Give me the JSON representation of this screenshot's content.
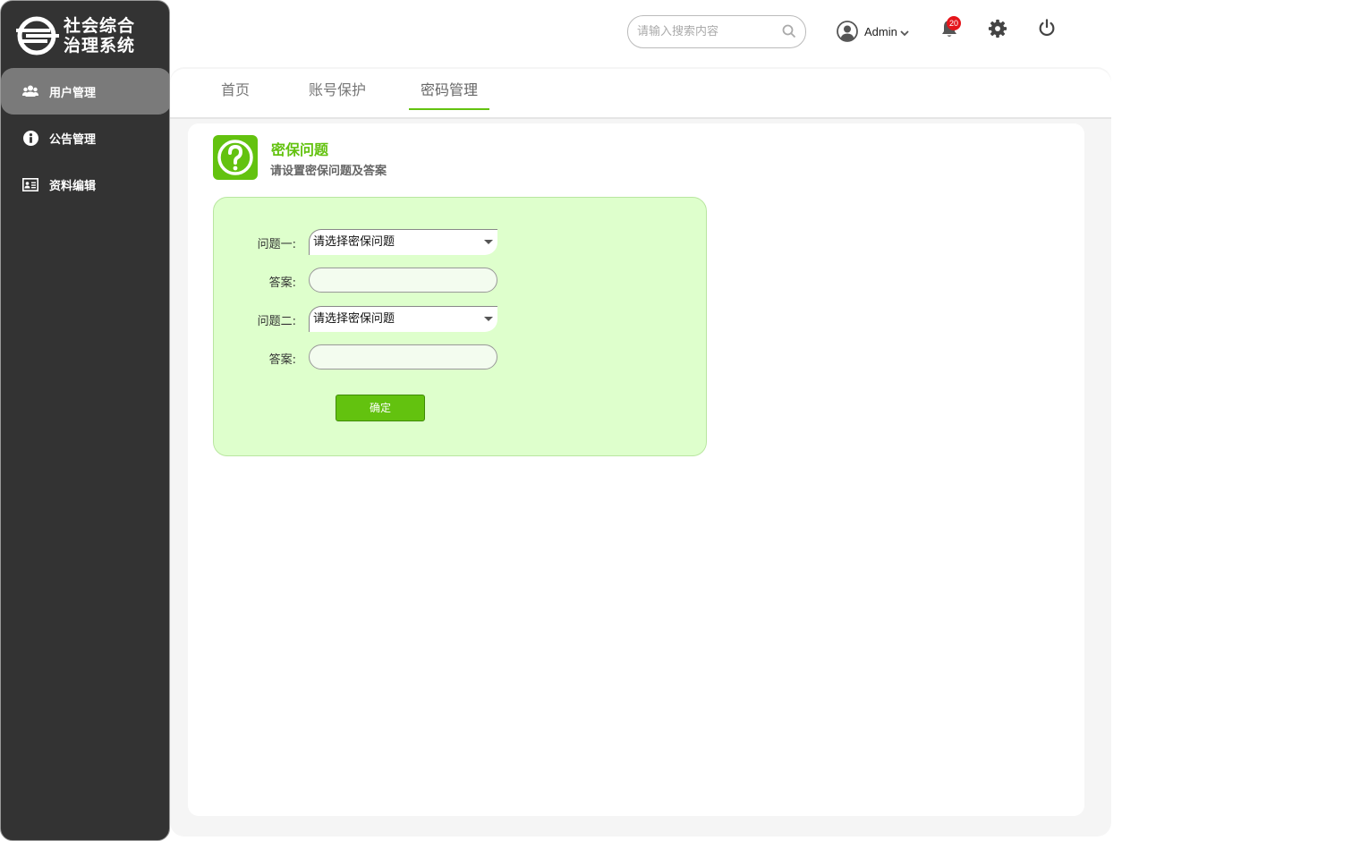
{
  "app": {
    "logo_line1": "社会综合",
    "logo_line2": "治理系统"
  },
  "sidebar": {
    "items": [
      {
        "label": "用户管理",
        "icon": "users-icon",
        "active": true
      },
      {
        "label": "公告管理",
        "icon": "info-icon",
        "active": false
      },
      {
        "label": "资料编辑",
        "icon": "id-card-icon",
        "active": false
      }
    ]
  },
  "topbar": {
    "search_placeholder": "请输入搜索内容",
    "user_name": "Admin",
    "notification_count": "20"
  },
  "tabs": [
    {
      "label": "首页",
      "active": false
    },
    {
      "label": "账号保护",
      "active": false
    },
    {
      "label": "密码管理",
      "active": true
    }
  ],
  "section": {
    "title": "密保问题",
    "subtitle": "请设置密保问题及答案"
  },
  "form": {
    "q1_label": "问题一:",
    "q1_value": "请选择密保问题",
    "a1_label": "答案:",
    "a1_value": "",
    "q2_label": "问题二:",
    "q2_value": "请选择密保问题",
    "a2_label": "答案:",
    "a2_value": "",
    "submit_label": "确定"
  },
  "colors": {
    "accent": "#63c20f",
    "sidebar_bg": "#333333",
    "form_bg": "#deffcc",
    "badge": "#e4151b"
  }
}
